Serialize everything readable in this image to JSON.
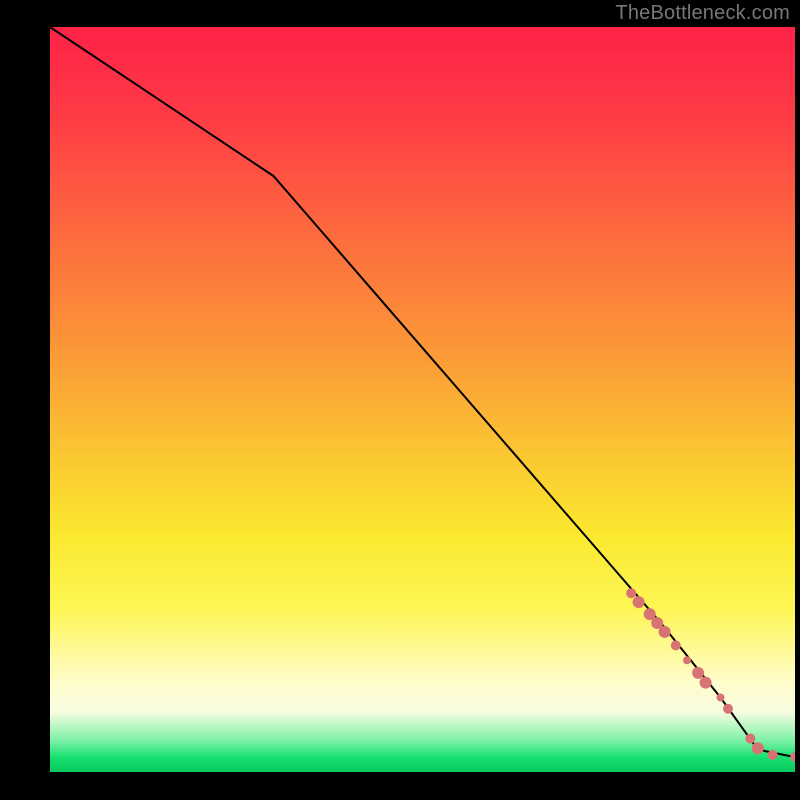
{
  "attribution": "TheBottleneck.com",
  "chart_data": {
    "type": "line",
    "title": "",
    "xlabel": "",
    "ylabel": "",
    "xlim": [
      0,
      100
    ],
    "ylim": [
      0,
      100
    ],
    "grid": false,
    "series": [
      {
        "name": "curve",
        "x": [
          0,
          30,
          82,
          90,
          95,
          100
        ],
        "values": [
          100,
          80,
          20,
          10,
          3,
          2
        ]
      }
    ],
    "markers": {
      "name": "highlight-points",
      "color": "#d87373",
      "points": [
        {
          "x": 78,
          "y": 24,
          "r": 5
        },
        {
          "x": 79,
          "y": 22.8,
          "r": 6
        },
        {
          "x": 80.5,
          "y": 21.2,
          "r": 6
        },
        {
          "x": 81.5,
          "y": 20.0,
          "r": 6
        },
        {
          "x": 82.5,
          "y": 18.8,
          "r": 6
        },
        {
          "x": 84,
          "y": 17.0,
          "r": 5
        },
        {
          "x": 85.5,
          "y": 15.0,
          "r": 4
        },
        {
          "x": 87,
          "y": 13.3,
          "r": 6
        },
        {
          "x": 88,
          "y": 12.0,
          "r": 6
        },
        {
          "x": 90,
          "y": 10.0,
          "r": 4
        },
        {
          "x": 91,
          "y": 8.5,
          "r": 5
        },
        {
          "x": 94,
          "y": 4.5,
          "r": 5
        },
        {
          "x": 95,
          "y": 3.2,
          "r": 6
        },
        {
          "x": 97,
          "y": 2.3,
          "r": 5
        },
        {
          "x": 100,
          "y": 2.0,
          "r": 5
        }
      ]
    }
  }
}
